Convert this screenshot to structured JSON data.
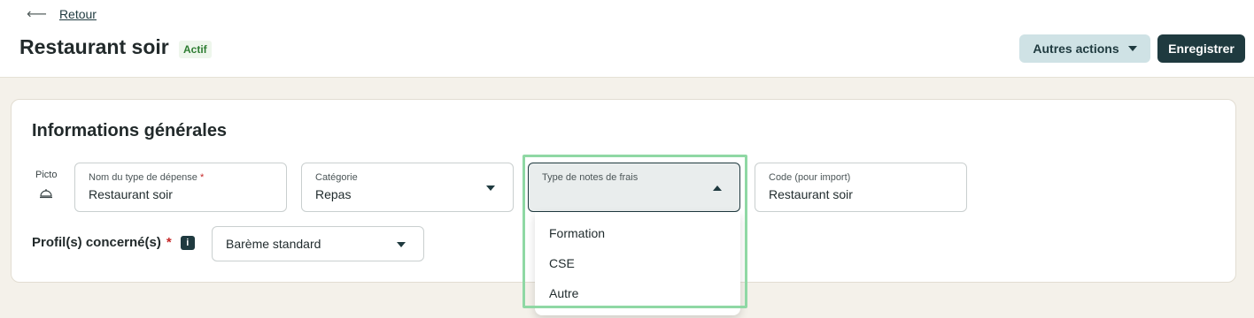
{
  "header": {
    "back_arrow": "⟵",
    "back_label": "Retour",
    "title": "Restaurant soir",
    "status_badge": "Actif",
    "more_actions_label": "Autres actions",
    "save_label": "Enregistrer"
  },
  "section": {
    "title": "Informations générales"
  },
  "picto": {
    "label": "Picto",
    "icon": "cloche-icon"
  },
  "fields": {
    "name": {
      "label": "Nom du type de dépense",
      "required_mark": "*",
      "value": "Restaurant soir"
    },
    "category": {
      "label": "Catégorie",
      "value": "Repas"
    },
    "expense_type": {
      "label": "Type de notes de frais",
      "value": ""
    },
    "code": {
      "label": "Code (pour import)",
      "value": "Restaurant soir"
    }
  },
  "profil": {
    "label": "Profil(s) concerné(s)",
    "required_mark": "*",
    "info_icon": "i",
    "value": "Barème standard"
  },
  "dropdown": {
    "options": [
      "Formation",
      "CSE",
      "Autre"
    ]
  },
  "colors": {
    "primary": "#1f3a3f",
    "secondary_button": "#cfe2e5",
    "highlight": "#8fd8a4",
    "background": "#f4f1ea"
  }
}
